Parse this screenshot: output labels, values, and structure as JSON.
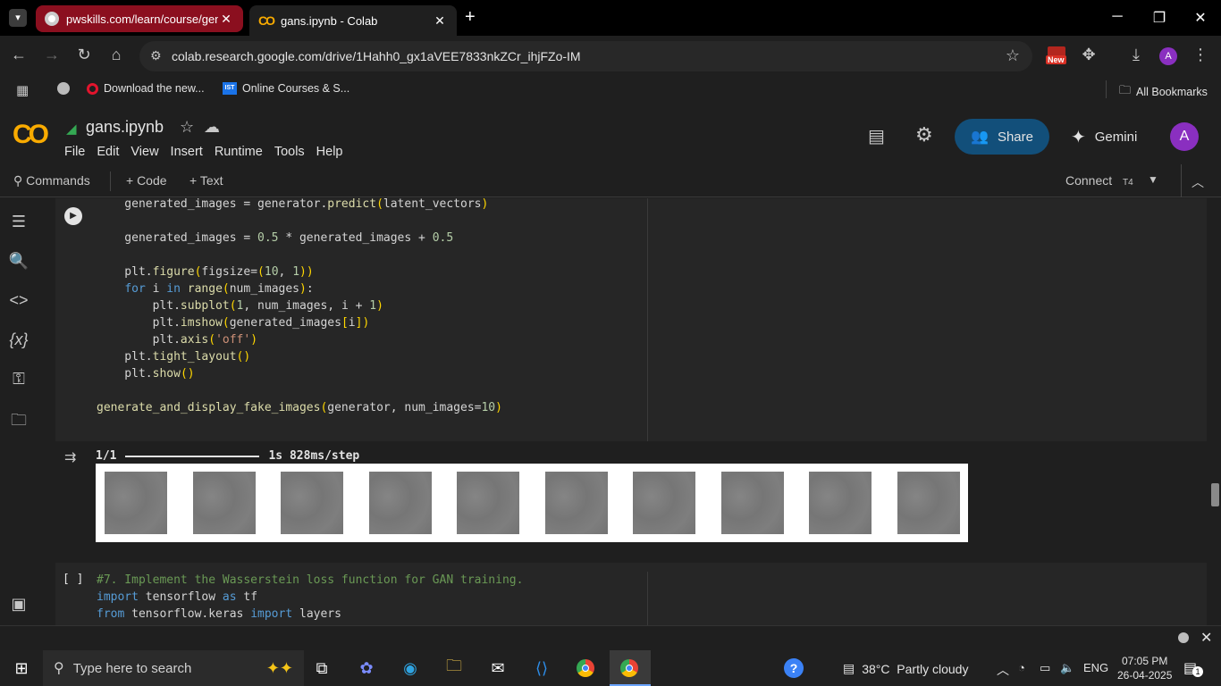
{
  "browser": {
    "tabs": [
      {
        "title": "pwskills.com/learn/course/gena"
      },
      {
        "title": "gans.ipynb - Colab"
      }
    ],
    "url": "colab.research.google.com/drive/1Hahh0_gx1aVEE7833nkZCr_ihjFZo-IM",
    "new_badge": "New",
    "profile_initial": "A",
    "bookmarks": [
      {
        "label": "Download the new..."
      },
      {
        "label": "Online Courses & S..."
      }
    ],
    "all_bookmarks": "All Bookmarks"
  },
  "colab": {
    "notebook_title": "gans.ipynb",
    "menu": [
      "File",
      "Edit",
      "View",
      "Insert",
      "Runtime",
      "Tools",
      "Help"
    ],
    "share_label": "Share",
    "gemini_label": "Gemini",
    "avatar_initial": "A",
    "commands_label": "Commands",
    "add_code_label": "+ Code",
    "add_text_label": "+ Text",
    "connect_label": "Connect",
    "runtime_type": "T4"
  },
  "cell1": {
    "lines": [
      "    generated_images = generator.predict(latent_vectors)",
      "",
      "    generated_images = 0.5 * generated_images + 0.5",
      "",
      "    plt.figure(figsize=(10, 1))",
      "    for i in range(num_images):",
      "        plt.subplot(1, num_images, i + 1)",
      "        plt.imshow(generated_images[i])",
      "        plt.axis('off')",
      "    plt.tight_layout()",
      "    plt.show()",
      "",
      "generate_and_display_fake_images(generator, num_images=10)"
    ],
    "output_progress": "1/1",
    "output_timing": "1s 828ms/step",
    "progress_fraction": 1.0,
    "generated_image_count": 10
  },
  "cell2": {
    "exec_label": "[ ]",
    "lines": [
      "#7. Implement the Wasserstein loss function for GAN training.",
      "import tensorflow as tf",
      "from tensorflow.keras import layers"
    ]
  },
  "taskbar": {
    "search_placeholder": "Type here to search",
    "weather": "38°C  Partly cloudy",
    "language": "ENG",
    "time": "07:05 PM",
    "date": "26-04-2025",
    "notification_count": "1"
  }
}
